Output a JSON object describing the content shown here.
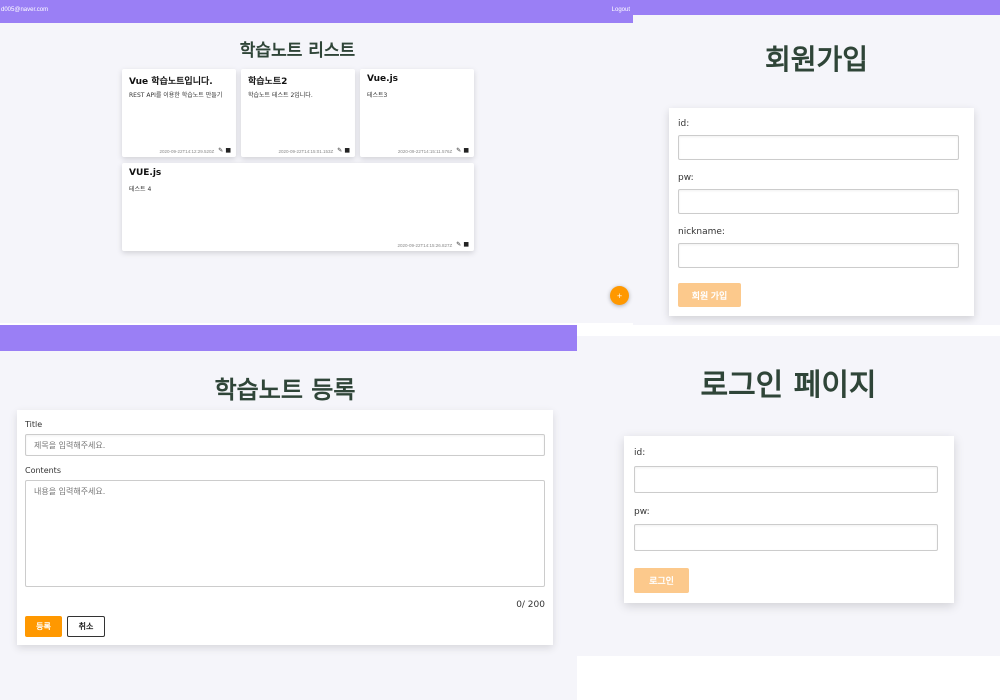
{
  "list_page": {
    "header": {
      "user_email": "d005@naver.com",
      "logout_label": "Logout"
    },
    "title": "학습노트 리스트",
    "notes": [
      {
        "title": "Vue 학습노트입니다.",
        "content": "REST API를 이용한 학습노트 만들기",
        "date": "2020-09-22T14:12:29.520Z"
      },
      {
        "title": "학습노트2",
        "content": "학습노트 테스트 2입니다.",
        "date": "2020-09-22T14:15:01.153Z"
      },
      {
        "title": "Vue.js",
        "content": "테스트3",
        "date": "2020-09-22T14:15:11.576Z"
      },
      {
        "title": "VUE.js",
        "content": "테스트 4",
        "date": "2020-09-22T14:15:26.827Z"
      }
    ],
    "fab_label": "+"
  },
  "register_page": {
    "title": "회원가입",
    "id_label": "id:",
    "pw_label": "pw:",
    "nickname_label": "nickname:",
    "submit_label": "회원 가입"
  },
  "note_create_page": {
    "title": "학습노트 등록",
    "title_label": "Title",
    "title_placeholder": "제목을 입력해주세요.",
    "contents_label": "Contents",
    "contents_placeholder": "내용을 입력해주세요.",
    "counter": "0/ 200",
    "submit_label": "등록",
    "cancel_label": "취소"
  },
  "login_page": {
    "title": "로그인 페이지",
    "id_label": "id:",
    "pw_label": "pw:",
    "submit_label": "로그인"
  },
  "colors": {
    "header_purple": "#9a7ff5",
    "accent_orange": "#ff9800",
    "disabled_orange": "#fcc98c",
    "title_green": "#2f4538",
    "background": "#f5f5fa"
  }
}
